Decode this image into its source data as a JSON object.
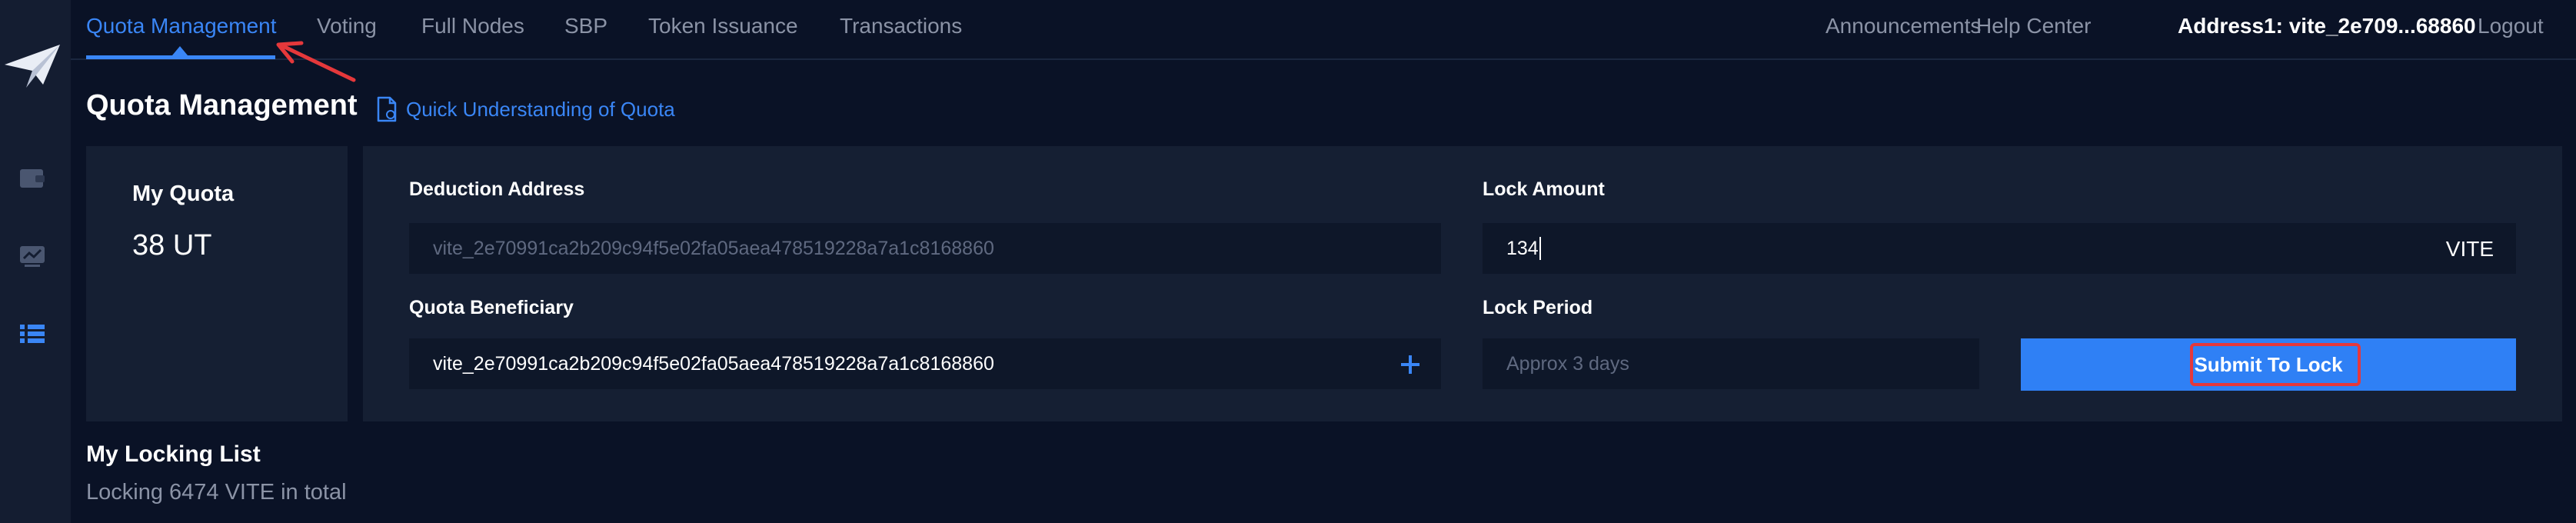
{
  "nav": {
    "tabs": [
      {
        "label": "Quota Management",
        "active": true
      },
      {
        "label": "Voting"
      },
      {
        "label": "Full Nodes"
      },
      {
        "label": "SBP"
      },
      {
        "label": "Token Issuance"
      },
      {
        "label": "Transactions"
      }
    ],
    "announcements": "Announcements",
    "help_center": "Help Center",
    "address": "Address1: vite_2e709...68860",
    "logout": "Logout"
  },
  "sidebar": {
    "icons": [
      "paper-plane-logo-icon",
      "wallet-icon",
      "chart-icon",
      "list-icon"
    ]
  },
  "page": {
    "title": "Quota Management",
    "quick_link": "Quick Understanding of Quota"
  },
  "quota_card": {
    "label": "My Quota",
    "value": "38 UT"
  },
  "form": {
    "deduction_address_label": "Deduction Address",
    "deduction_address_value": "vite_2e70991ca2b209c94f5e02fa05aea478519228a7a1c8168860",
    "beneficiary_label": "Quota Beneficiary",
    "beneficiary_value": "vite_2e70991ca2b209c94f5e02fa05aea478519228a7a1c8168860",
    "lock_amount_label": "Lock Amount",
    "lock_amount_value": "134",
    "lock_amount_unit": "VITE",
    "lock_period_label": "Lock Period",
    "lock_period_placeholder": "Approx 3 days",
    "submit_label": "Submit To Lock"
  },
  "locking_list": {
    "title": "My Locking List",
    "summary": "Locking 6474 VITE in total"
  },
  "colors": {
    "background": "#0a1226",
    "panel": "#151f33",
    "accent": "#3a86f6",
    "annotation": "#e5383b"
  }
}
